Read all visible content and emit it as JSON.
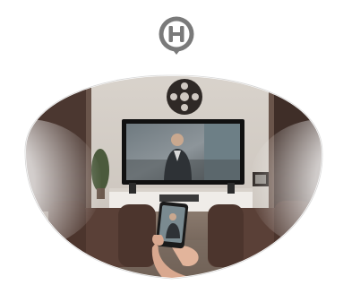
{
  "pin": {
    "letter": "H",
    "icon": "h-location-pin-icon",
    "color": "#7a7a7a"
  },
  "scene": {
    "icon": "lens-room-scene",
    "colors": {
      "wall": "#d3cdc6",
      "dark_wood": "#4b3730",
      "sofa": "#5a4037",
      "tv_frame": "#111111",
      "lens_outline": "#ffffff",
      "haze": "#ffffff"
    }
  }
}
